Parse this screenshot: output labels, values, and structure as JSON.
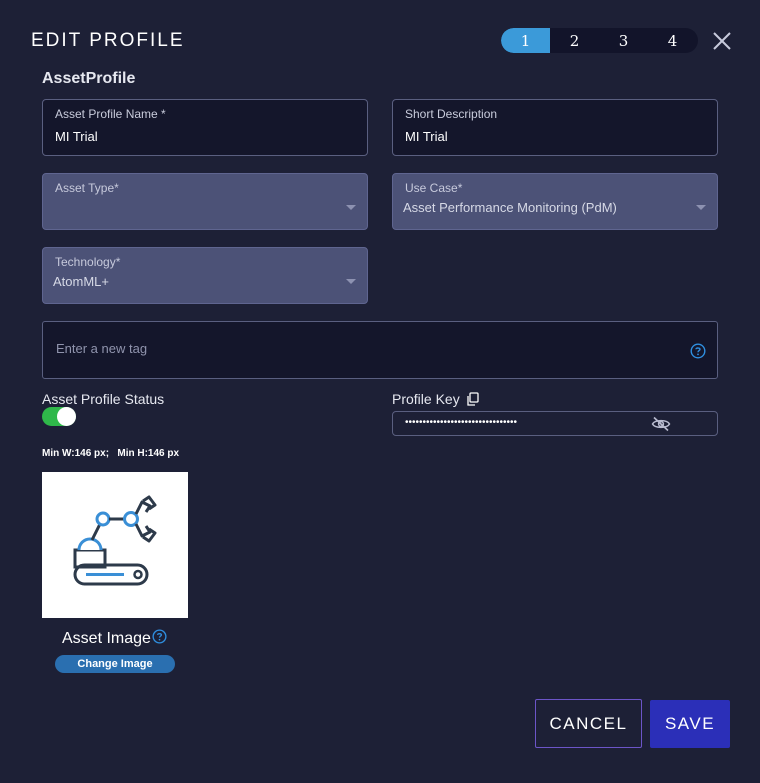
{
  "dialog": {
    "title": "EDIT PROFILE",
    "steps": [
      "1",
      "2",
      "3",
      "4"
    ],
    "active_step": "1",
    "close_icon": "close-icon"
  },
  "section": {
    "title": "AssetProfile"
  },
  "fields": {
    "asset_profile_name": {
      "label": "Asset Profile Name *",
      "value": "MI Trial"
    },
    "short_description": {
      "label": "Short Description",
      "value": "MI Trial"
    },
    "asset_type": {
      "label": "Asset Type*",
      "value": ""
    },
    "use_case": {
      "label": "Use Case*",
      "value": "Asset Performance Monitoring (PdM)"
    },
    "technology": {
      "label": "Technology*",
      "value": "AtomML+"
    }
  },
  "tags": {
    "placeholder": "Enter a new tag",
    "help_icon": "question-circle-icon"
  },
  "status": {
    "label": "Asset Profile Status",
    "enabled": true
  },
  "profile_key": {
    "label": "Profile Key",
    "masked_value": "••••••••••••••••••••••••••••••••",
    "copy_icon": "copy-icon",
    "visibility_icon": "eye-slash-icon"
  },
  "image": {
    "min_dims": "Min W:146 px;   Min H:146 px",
    "label": "Asset Image",
    "change_label": "Change Image",
    "icon": "robot-arm-icon"
  },
  "actions": {
    "cancel_label": "CANCEL",
    "save_label": "SAVE"
  },
  "colors": {
    "background": "#1d2036",
    "accent_step": "#3b9ad9",
    "toggle_on": "#2fb84a",
    "save_button": "#2b2fb8",
    "cancel_border": "#6c55c8",
    "select_field": "#4c5277"
  }
}
